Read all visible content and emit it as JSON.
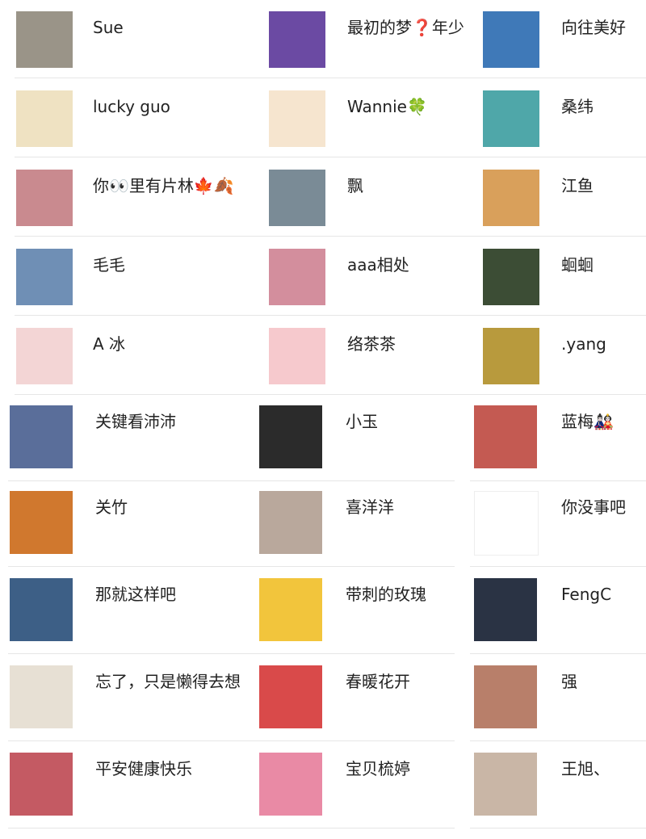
{
  "columns": [
    {
      "contacts": [
        {
          "name": "Sue",
          "avatar_color": "#9a9488",
          "icon": "child-photo-avatar"
        },
        {
          "name": "lucky guo",
          "avatar_color": "#efe2c2",
          "icon": "cartoon-cat-avatar"
        },
        {
          "name": "你👀里有片林🍁🍂",
          "avatar_color": "#c98a8f",
          "icon": "girl-selfie-avatar"
        },
        {
          "name": "毛毛",
          "avatar_color": "#6f8fb5",
          "icon": "castle-photo-avatar"
        },
        {
          "name": "A 冰",
          "avatar_color": "#f3d5d5",
          "icon": "anime-girl-avatar"
        },
        {
          "name": "关键看沛沛",
          "avatar_color": "#5a6e9a",
          "icon": "crayon-shin-chan-avatar"
        },
        {
          "name": "关竹",
          "avatar_color": "#d0782e",
          "icon": "fireworks-photo-avatar"
        },
        {
          "name": "那就这样吧",
          "avatar_color": "#3d5f86",
          "icon": "sunset-couple-avatar"
        },
        {
          "name": "忘了，只是懒得去想",
          "avatar_color": "#e7e0d4",
          "icon": "detective-conan-avatar"
        },
        {
          "name": "平安健康快乐",
          "avatar_color": "#c45a63",
          "icon": "kid-photo-avatar"
        }
      ]
    },
    {
      "contacts": [
        {
          "name": "最初的梦❓年少",
          "avatar_color": "#6b4aa3",
          "icon": "woman-photo-avatar"
        },
        {
          "name": "Wannie🍀",
          "avatar_color": "#f6e5cf",
          "icon": "cartoon-girl-avatar"
        },
        {
          "name": "飘",
          "avatar_color": "#7a8b96",
          "icon": "landscape-avatar"
        },
        {
          "name": "aaa相处",
          "avatar_color": "#d38e9d",
          "icon": "child-face-avatar"
        },
        {
          "name": "络茶茶",
          "avatar_color": "#f6c9cd",
          "icon": "pink-pig-avatar"
        },
        {
          "name": "小玉",
          "avatar_color": "#2b2b2b",
          "icon": "holding-hands-avatar"
        },
        {
          "name": "喜洋洋",
          "avatar_color": "#b9a89c",
          "icon": "group-photo-avatar"
        },
        {
          "name": "带刺的玫瑰",
          "avatar_color": "#f2c53c",
          "icon": "yellow-flower-avatar"
        },
        {
          "name": "春暖花开",
          "avatar_color": "#d94a4a",
          "icon": "china-cheer-avatar"
        },
        {
          "name": "宝贝梳婷",
          "avatar_color": "#e98aa5",
          "icon": "rose-bouquet-avatar"
        }
      ]
    },
    {
      "contacts": [
        {
          "name": "向往美好",
          "avatar_color": "#3f79b8",
          "icon": "city-skyline-avatar"
        },
        {
          "name": "桑纬",
          "avatar_color": "#4fa7a9",
          "icon": "police-cartoon-avatar"
        },
        {
          "name": "江鱼",
          "avatar_color": "#d9a05b",
          "icon": "shiba-dog-avatar"
        },
        {
          "name": "蛔蛔",
          "avatar_color": "#3c4d35",
          "icon": "lotus-flower-avatar"
        },
        {
          "name": ".yang",
          "avatar_color": "#b89a3d",
          "icon": "woman-photo-avatar"
        },
        {
          "name": "蓝梅🎎",
          "avatar_color": "#c45a52",
          "icon": "flower-sunset-avatar"
        },
        {
          "name": "你没事吧",
          "avatar_color": "#ffffff",
          "icon": "cloud-avatar"
        },
        {
          "name": "FengC",
          "avatar_color": "#2a3344",
          "icon": "wolf-avatar"
        },
        {
          "name": "强",
          "avatar_color": "#b87f6a",
          "icon": "baby-photo-avatar"
        },
        {
          "name": "王旭、",
          "avatar_color": "#c9b6a6",
          "icon": "baby-hat-avatar"
        }
      ]
    }
  ]
}
